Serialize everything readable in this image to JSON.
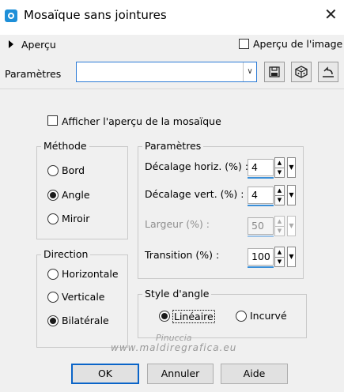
{
  "window": {
    "title": "Mosaïque sans jointures"
  },
  "header": {
    "apercu_label": "Aperçu",
    "apercu_image_label": "Aperçu de l'image",
    "parametres_label": "Paramètres",
    "preset_value": ""
  },
  "options": {
    "afficher_apercu_label": "Afficher l'aperçu de la mosaïque"
  },
  "methode": {
    "title": "Méthode",
    "options": [
      "Bord",
      "Angle",
      "Miroir"
    ],
    "selected": "Angle"
  },
  "direction": {
    "title": "Direction",
    "options": [
      "Horizontale",
      "Verticale",
      "Bilatérale"
    ],
    "selected": "Bilatérale"
  },
  "parametres": {
    "title": "Paramètres",
    "decalage_horiz_label": "Décalage horiz. (%) :",
    "decalage_horiz_value": "4",
    "decalage_vert_label": "Décalage vert. (%) :",
    "decalage_vert_value": "4",
    "largeur_label": "Largeur (%) :",
    "largeur_value": "50",
    "transition_label": "Transition (%) :",
    "transition_value": "100"
  },
  "style_angle": {
    "title": "Style d'angle",
    "options": [
      "Linéaire",
      "Incurvé"
    ],
    "selected": "Linéaire"
  },
  "watermark": {
    "line1": "Pinuccia",
    "line2": "www.maldiregrafica.eu"
  },
  "buttons": {
    "ok": "OK",
    "annuler": "Annuler",
    "aide": "Aide"
  },
  "colors": {
    "accent": "#0a64c8",
    "spin_underline": "#3a8fd8"
  }
}
